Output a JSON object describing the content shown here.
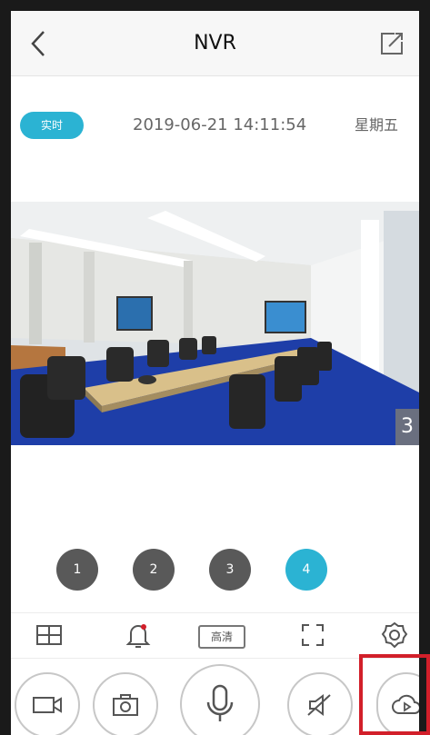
{
  "header": {
    "title": "NVR",
    "back_icon": "chevron-left-icon",
    "share_icon": "share-icon"
  },
  "status": {
    "live_label": "实时",
    "datetime": "2019-06-21 14:11:54",
    "weekday": "星期五"
  },
  "video": {
    "camera_number": "3"
  },
  "channels": [
    {
      "label": "1",
      "active": false
    },
    {
      "label": "2",
      "active": false
    },
    {
      "label": "3",
      "active": false
    },
    {
      "label": "4",
      "active": true
    }
  ],
  "tools": {
    "layout_icon": "grid-icon",
    "alarm_icon": "bell-icon",
    "quality_label": "高清",
    "fullscreen_icon": "fullscreen-icon",
    "settings_icon": "gear-icon"
  },
  "actions": {
    "record_icon": "video-camera-icon",
    "snapshot_icon": "camera-icon",
    "talk_icon": "microphone-icon",
    "mute_icon": "speaker-mute-icon",
    "cloud_icon": "cloud-playback-icon"
  },
  "colors": {
    "accent": "#2bb3d3",
    "channel_inactive": "#595959",
    "highlight": "#d21f2a"
  }
}
